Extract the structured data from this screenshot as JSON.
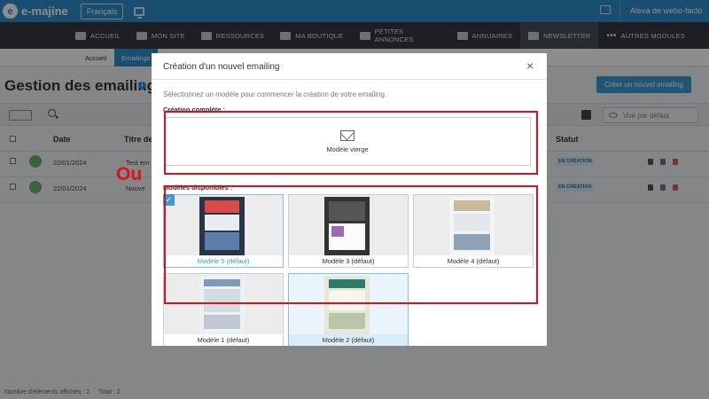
{
  "topbar": {
    "logo_text": "e-majine",
    "language": "Français",
    "user": "Alexa de webo-facto",
    "accent": "#2f8fce"
  },
  "nav": {
    "items": [
      {
        "label": "ACCUEIL",
        "icon": "home-icon"
      },
      {
        "label": "MON SITE",
        "icon": "monitor-icon"
      },
      {
        "label": "RESSOURCES",
        "icon": "folder-icon"
      },
      {
        "label": "MA BOUTIQUE",
        "icon": "basket-icon"
      },
      {
        "label": "PETITES ANNONCES",
        "icon": "tag-icon"
      },
      {
        "label": "ANNUAIRES",
        "icon": "list-icon"
      },
      {
        "label": "NEWSLETTER",
        "icon": "mail-icon",
        "active": true
      },
      {
        "label": "AUTRES MODULES",
        "icon": "dots-icon"
      }
    ]
  },
  "subnav": {
    "items": [
      "Accueil",
      "Emailings"
    ]
  },
  "page": {
    "title": "Gestion des emailings",
    "create_button": "Créer un nouvel emailing",
    "view_select": "Vue par défaut",
    "columns": {
      "date": "Date",
      "title": "Titre de",
      "status": "Statut"
    },
    "rows": [
      {
        "date": "22/01/2024",
        "title": "Test em",
        "status": "EN CRÉATION"
      },
      {
        "date": "22/01/2024",
        "title": "Nouve",
        "status": "EN CRÉATION"
      }
    ],
    "footer_count": "Nombre d'éléments affichés : 2",
    "footer_total": "Total : 2"
  },
  "modal": {
    "title": "Création d'un nouvel emailing",
    "close": "×",
    "description": "Sélectionnez un modèle pour commencer la création de votre emailing.",
    "section_complete": "Création complète :",
    "blank_label": "Modèle vierge",
    "section_models": "Modèles disponibles :",
    "templates": [
      {
        "label": "Modèle 5 (défaut)",
        "selected": true
      },
      {
        "label": "Modèle 3 (défaut)"
      },
      {
        "label": "Modèle 4 (défaut)"
      },
      {
        "label": "Modèle 1 (défaut)"
      },
      {
        "label": "Modèle 2 (défaut)",
        "hovered": true
      }
    ]
  },
  "annotation": {
    "text": "Ou",
    "color": "#e0101a"
  }
}
